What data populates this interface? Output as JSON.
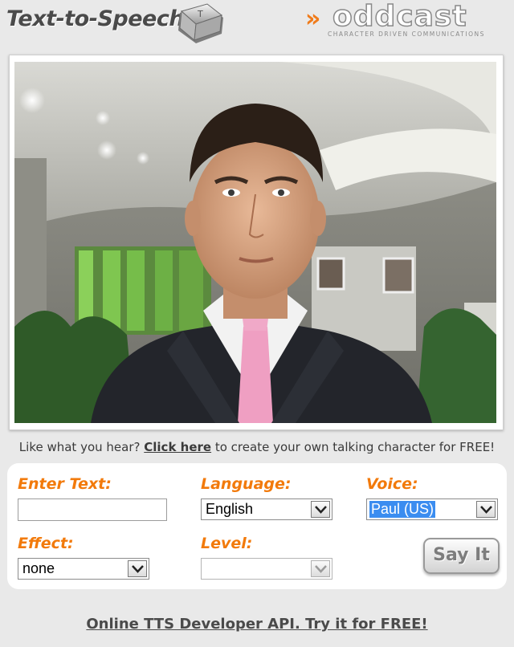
{
  "header": {
    "title": "Text-to-Speech",
    "key_icon_letter": "T",
    "brand_name": "oddcast",
    "brand_tagline": "CHARACTER DRIVEN COMMUNICATIONS",
    "brand_color": "#f27a0b"
  },
  "stage": {
    "character": "business-man-avatar",
    "background": "office-lobby"
  },
  "promo": {
    "prefix": "Like what you hear?",
    "link": "Click here",
    "suffix": "to create your own talking character for FREE!"
  },
  "form": {
    "enter_text_label": "Enter Text:",
    "enter_text_value": "",
    "language_label": "Language:",
    "language_value": "English",
    "voice_label": "Voice:",
    "voice_value": "Paul (US)",
    "effect_label": "Effect:",
    "effect_value": "none",
    "level_label": "Level:",
    "level_value": "",
    "say_it_label": "Say It"
  },
  "footer": {
    "api_link": "Online TTS Developer API. Try it for FREE!"
  }
}
